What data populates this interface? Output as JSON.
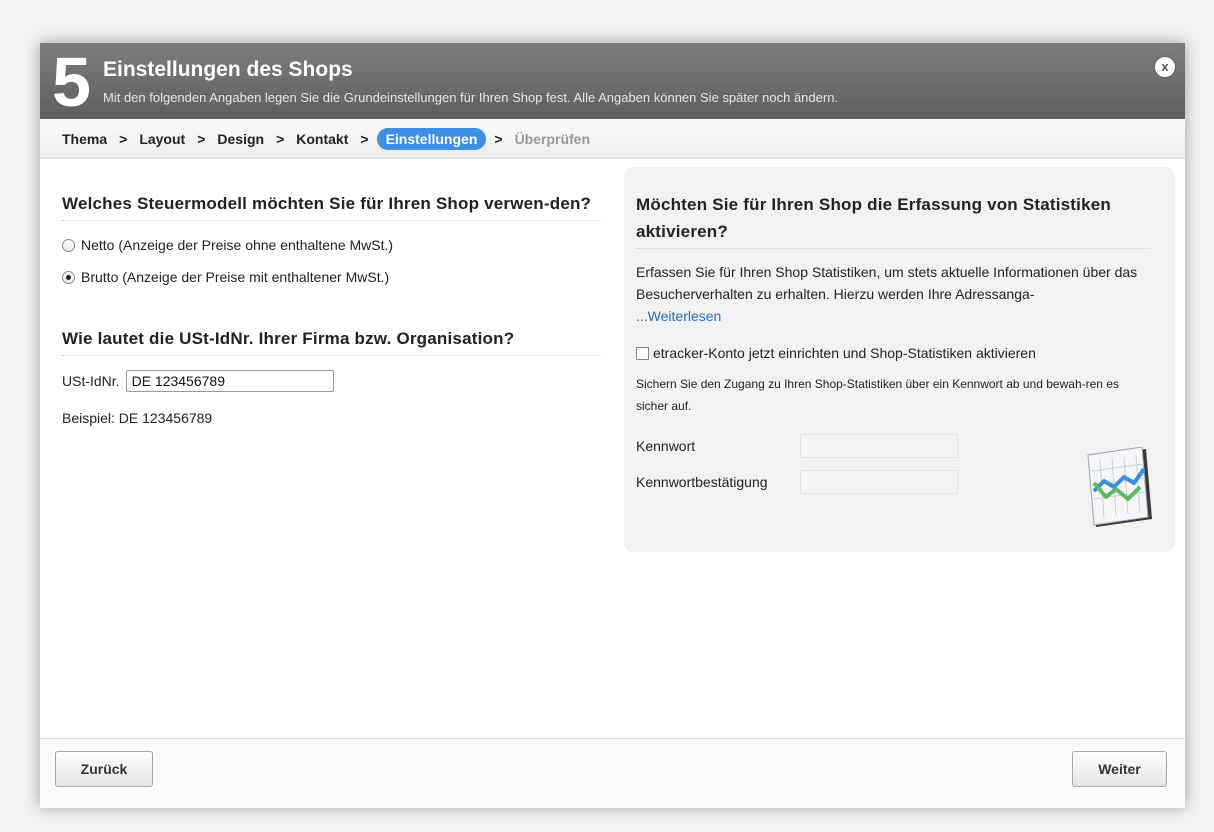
{
  "header": {
    "step": "5",
    "title": "Einstellungen des Shops",
    "subtitle": "Mit den folgenden Angaben legen Sie die Grundeinstellungen für Ihren Shop fest. Alle Angaben können Sie später noch ändern.",
    "close_label": "x"
  },
  "breadcrumb": {
    "separator": ">",
    "items": [
      {
        "label": "Thema"
      },
      {
        "label": "Layout"
      },
      {
        "label": "Design"
      },
      {
        "label": "Kontakt"
      },
      {
        "label": "Einstellungen"
      },
      {
        "label": "Überprüfen"
      }
    ]
  },
  "tax": {
    "title": "Welches Steuermodell möchten Sie für Ihren Shop verwen-den?",
    "options": [
      {
        "label": "Netto (Anzeige der Preise ohne enthaltene MwSt.)",
        "checked": false
      },
      {
        "label": "Brutto (Anzeige der Preise mit enthaltener MwSt.)",
        "checked": true
      }
    ]
  },
  "vat": {
    "title": "Wie lautet die USt-IdNr. Ihrer Firma bzw. Organisation?",
    "label": "USt-IdNr.",
    "value": "DE 123456789",
    "example": "Beispiel: DE 123456789"
  },
  "stats": {
    "title": "Möchten Sie für Ihren Shop die Erfassung von Statistiken aktivieren?",
    "description": "Erfassen Sie für Ihren Shop Statistiken, um stets aktuelle Informationen über das Besucherverhalten zu erhalten. Hierzu werden Ihre Adressanga-",
    "read_more": "...Weiterlesen",
    "checkbox_label": "etracker-Konto jetzt einrichten und Shop-Statistiken aktivieren",
    "checkbox_checked": false,
    "note": "Sichern Sie den Zugang zu Ihren Shop-Statistiken über ein Kennwort ab und bewah-ren es sicher auf.",
    "password_label": "Kennwort",
    "password_confirm_label": "Kennwortbestätigung",
    "icon": "statistics-chart-icon"
  },
  "footer": {
    "back_label": "Zurück",
    "next_label": "Weiter"
  },
  "colors": {
    "header_bg": "#6e6e6e",
    "active_crumb": "#3d8fe6",
    "link": "#2a6bc4"
  }
}
